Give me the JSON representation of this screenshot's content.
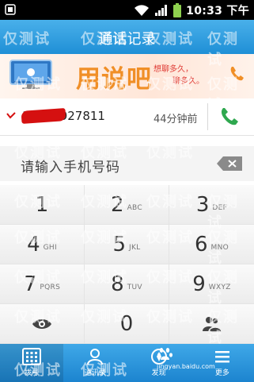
{
  "status_bar": {
    "time": "10:33 下午"
  },
  "title_bar": {
    "title": "通话记录"
  },
  "banner": {
    "slogan": "用说吧",
    "bubble_line1": "想聊多久，",
    "bubble_line2": "聊多久。"
  },
  "recent_call": {
    "number": "15461927811",
    "time_ago": "44分钟前"
  },
  "dial_input": {
    "placeholder": "请输入手机号码"
  },
  "keypad": {
    "keys": [
      {
        "digit": "1",
        "letters": ""
      },
      {
        "digit": "2",
        "letters": "ABC"
      },
      {
        "digit": "3",
        "letters": "DEF"
      },
      {
        "digit": "4",
        "letters": "GHI"
      },
      {
        "digit": "5",
        "letters": "JKL"
      },
      {
        "digit": "6",
        "letters": "MNO"
      },
      {
        "digit": "7",
        "letters": "PQRS"
      },
      {
        "digit": "8",
        "letters": "TUV"
      },
      {
        "digit": "9",
        "letters": "WXYZ"
      },
      {
        "digit": "",
        "letters": ""
      },
      {
        "digit": "0",
        "letters": ""
      },
      {
        "digit": "",
        "letters": ""
      }
    ]
  },
  "tabs": [
    {
      "label": "拨号"
    },
    {
      "label": "通讯录"
    },
    {
      "label": "发现"
    },
    {
      "label": "更多"
    }
  ],
  "watermark": {
    "text": "仅测试",
    "baidu_text": "jingyan.baidu.com"
  },
  "colors": {
    "title_blue": "#1f8fd6",
    "call_green": "#2fa84f",
    "missed_red": "#d51010",
    "slogan_orange": "#f08f27"
  }
}
